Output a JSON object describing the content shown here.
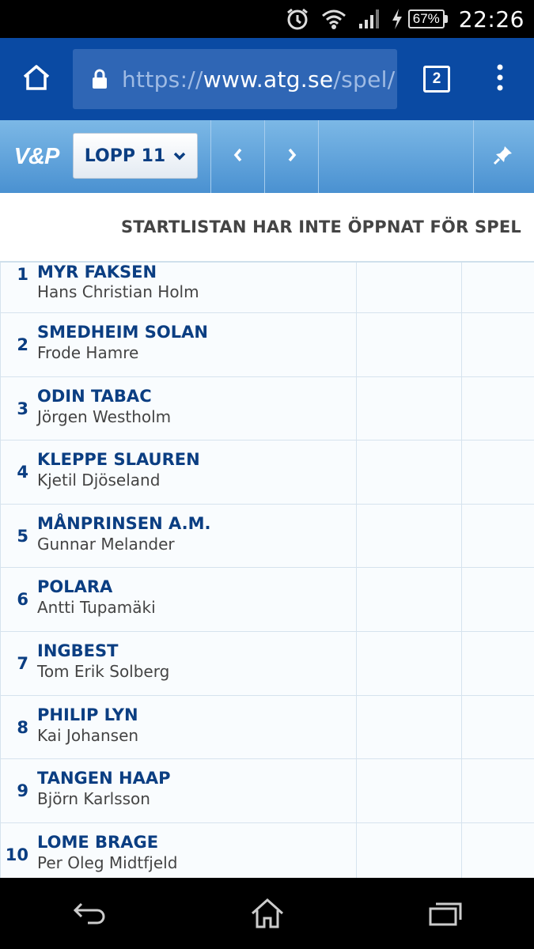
{
  "status_bar": {
    "battery": "67%",
    "time": "22:26"
  },
  "browser": {
    "url_prefix": "https://",
    "url_host": "www.atg.se",
    "url_rest": "/spel/",
    "tab_count": "2"
  },
  "race_nav": {
    "logo": "V&P",
    "race_label": "LOPP 11"
  },
  "list_header": {
    "message": "STARTLISTAN HAR INTE ÖPPNAT FÖR SPEL"
  },
  "starters": [
    {
      "number": "1",
      "horse": "MYR FAKSEN",
      "driver": "Hans Christian Holm"
    },
    {
      "number": "2",
      "horse": "SMEDHEIM SOLAN",
      "driver": "Frode Hamre"
    },
    {
      "number": "3",
      "horse": "ODIN TABAC",
      "driver": "Jörgen Westholm"
    },
    {
      "number": "4",
      "horse": "KLEPPE SLAUREN",
      "driver": "Kjetil Djöseland"
    },
    {
      "number": "5",
      "horse": "MÅNPRINSEN A.M.",
      "driver": "Gunnar Melander"
    },
    {
      "number": "6",
      "horse": "POLARA",
      "driver": "Antti Tupamäki"
    },
    {
      "number": "7",
      "horse": "INGBEST",
      "driver": "Tom Erik Solberg"
    },
    {
      "number": "8",
      "horse": "PHILIP LYN",
      "driver": "Kai Johansen"
    },
    {
      "number": "9",
      "horse": "TANGEN HAAP",
      "driver": "Björn Karlsson"
    },
    {
      "number": "10",
      "horse": "LOME BRAGE",
      "driver": "Per Oleg Midtfjeld"
    }
  ],
  "icons": {
    "status": [
      "alarm-icon",
      "wifi-icon",
      "signal-icon",
      "charging-icon",
      "battery-icon"
    ],
    "browser": [
      "home-icon",
      "lock-icon",
      "tabs-icon",
      "overflow-menu-icon"
    ],
    "race_nav": [
      "chevron-down-icon",
      "chevron-left-icon",
      "chevron-right-icon",
      "pin-icon"
    ],
    "system_nav": [
      "back-icon",
      "home-icon",
      "recents-icon"
    ]
  },
  "colors": {
    "browser_bar": "#0a4aa3",
    "race_bar": "#5aa0da",
    "horse_name": "#0b3e82",
    "driver_name": "#444444"
  }
}
